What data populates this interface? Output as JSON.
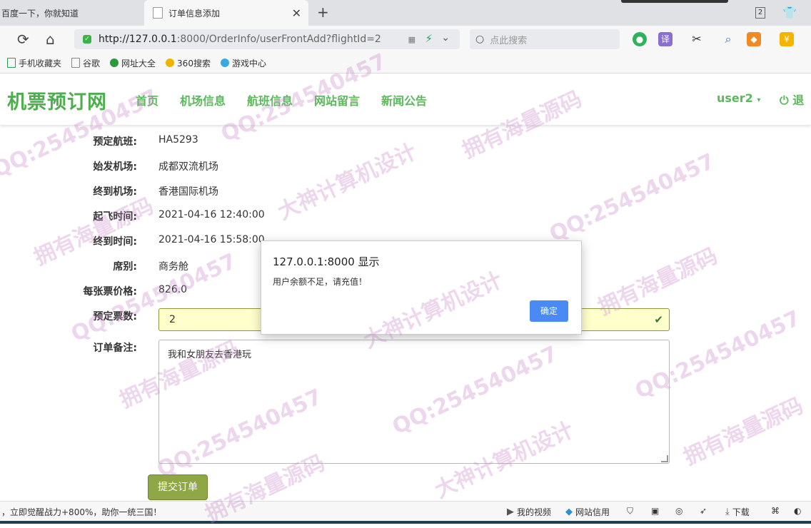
{
  "browser": {
    "tabs": [
      {
        "title": "百度一下，你就知道"
      },
      {
        "title": "订单信息添加"
      }
    ],
    "tab_count": "2",
    "url_host": "http://127.0.0.1",
    "url_rest": ":8000/OrderInfo/userFrontAdd?flightId=2",
    "search_placeholder": "点此搜索",
    "ext_translate": "译",
    "ext_money": "¥"
  },
  "bookmarks": [
    {
      "label": "手机收藏夹"
    },
    {
      "label": "谷歌"
    },
    {
      "label": "网址大全"
    },
    {
      "label": "360搜索"
    },
    {
      "label": "游戏中心"
    }
  ],
  "site": {
    "brand": "机票预订网",
    "nav": [
      {
        "label": "首页"
      },
      {
        "label": "机场信息"
      },
      {
        "label": "航班信息"
      },
      {
        "label": "网站留言"
      },
      {
        "label": "新闻公告"
      }
    ],
    "user": "user2",
    "logout": "退"
  },
  "form": {
    "fields": [
      {
        "label": "预定航班:",
        "value": "HA5293"
      },
      {
        "label": "始发机场:",
        "value": "成都双流机场"
      },
      {
        "label": "终到机场:",
        "value": "香港国际机场"
      },
      {
        "label": "起飞时间:",
        "value": "2021-04-16 12:40:00"
      },
      {
        "label": "终到时间:",
        "value": "2021-04-16 15:58:00"
      },
      {
        "label": "席别:",
        "value": "商务舱"
      },
      {
        "label": "每张票价格:",
        "value": "826.0"
      }
    ],
    "quantity_label": "预定票数:",
    "quantity_value": "2",
    "note_label": "订单备注:",
    "note_value": "我和女朋友去香港玩",
    "submit_label": "提交订单"
  },
  "dialog": {
    "title": "127.0.0.1:8000 显示",
    "message": "用户余额不足，请充值！",
    "ok_label": "确定"
  },
  "status": {
    "ad_text": "，立即觉醒战力+800%，助你一统三国！",
    "my_video": "我的视频",
    "web_credit": "网站信用",
    "download": "下载"
  },
  "watermarks": [
    "QQ:254540457",
    "拥有海量源码",
    "大神计算机设计"
  ],
  "colors": {
    "brand_green": "#4cae4c",
    "nav_green": "#5cb85c",
    "submit_olive": "#8fa746",
    "dialog_button": "#4a8af4"
  }
}
